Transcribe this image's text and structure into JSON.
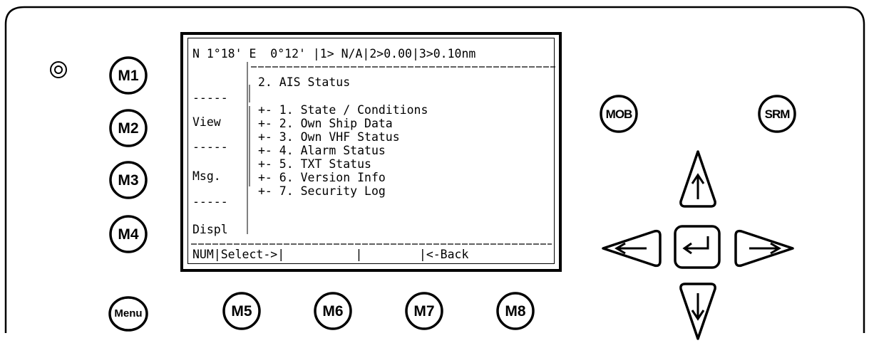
{
  "left_buttons": [
    {
      "label": "M1"
    },
    {
      "label": "M2"
    },
    {
      "label": "M3"
    },
    {
      "label": "M4"
    },
    {
      "label": "Menu"
    }
  ],
  "bottom_buttons": [
    {
      "label": "M5"
    },
    {
      "label": "M6"
    },
    {
      "label": "M7"
    },
    {
      "label": "M8"
    }
  ],
  "right_buttons": {
    "mob": "MOB",
    "srm": "SRM"
  },
  "arrow_keys": {
    "up": "up-arrow",
    "left": "left-arrow",
    "enter": "enter-arrow",
    "right": "right-arrow",
    "down": "down-arrow"
  },
  "screen": {
    "status_line": "N 1°18' E  0°12' |1> N/A|2>0.00|3>0.10nm",
    "softkeys_left": [
      {
        "text": "-----"
      },
      {
        "text": "View"
      },
      {
        "text": "-----"
      },
      {
        "text": "Msg."
      },
      {
        "text": "-----"
      },
      {
        "text": "Displ"
      }
    ],
    "menu_title": "2. AIS Status",
    "menu_items": [
      {
        "label": "+- 1. State / Conditions"
      },
      {
        "label": "+- 2. Own Ship Data"
      },
      {
        "label": "+- 3. Own VHF Status"
      },
      {
        "label": "+- 4. Alarm Status"
      },
      {
        "label": "+- 5. TXT Status"
      },
      {
        "label": "+- 6. Version Info"
      },
      {
        "label": "+- 7. Security Log"
      }
    ],
    "bottom_bar": "NUM|Select->|          |        |<-Back"
  }
}
